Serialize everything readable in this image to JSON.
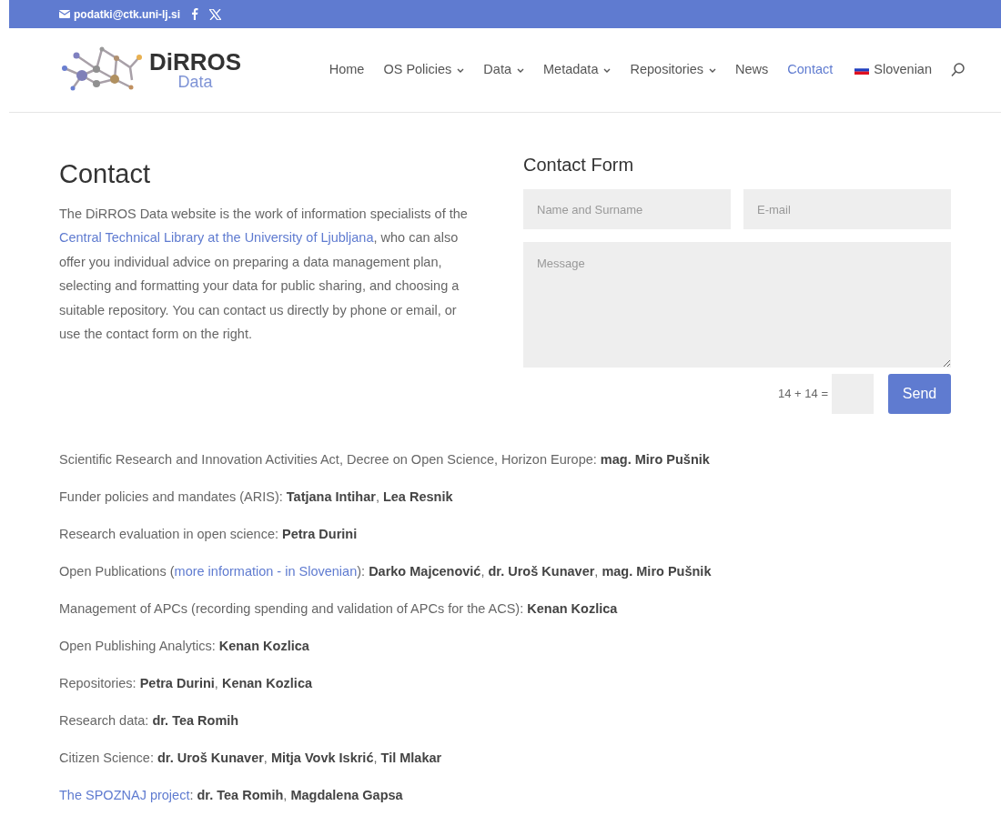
{
  "top_bar": {
    "email": "podatki@ctk.uni-lj.si"
  },
  "logo": {
    "name": "DiRROS",
    "sub": "Data"
  },
  "nav": [
    {
      "label": "Home",
      "dropdown": false,
      "selected": false
    },
    {
      "label": "OS Policies",
      "dropdown": true,
      "selected": false
    },
    {
      "label": "Data",
      "dropdown": true,
      "selected": false
    },
    {
      "label": "Metadata",
      "dropdown": true,
      "selected": false
    },
    {
      "label": "Repositories",
      "dropdown": true,
      "selected": false
    },
    {
      "label": "News",
      "dropdown": false,
      "selected": false
    },
    {
      "label": "Contact",
      "dropdown": false,
      "selected": true
    }
  ],
  "language": "Slovenian",
  "heading": "Contact",
  "intro": [
    {
      "kind": "text",
      "text": "The DiRROS Data website is the work of information specialists of the "
    },
    {
      "kind": "link",
      "text": "Central Technical Library at the University of Ljubljana"
    },
    {
      "kind": "text",
      "text": ", who can also offer you individual advice on preparing a data management plan, selecting and formatting your data for public sharing, and choosing a suitable repository. You can contact us directly by phone or email, or use the contact form on the right."
    }
  ],
  "form": {
    "title": "Contact Form",
    "name_placeholder": "Name and Surname",
    "email_placeholder": "E-mail",
    "message_placeholder": "Message",
    "captcha": "14 + 14 =",
    "send": "Send"
  },
  "contacts": [
    [
      {
        "kind": "text",
        "text": "Scientific Research and Innovation Activities Act, Decree on Open Science, Horizon Europe: **mag. Miro Pušnik**"
      }
    ],
    [
      {
        "kind": "text",
        "text": "Funder policies and mandates (ARIS): **Tatjana Intihar**, **Lea Resnik**"
      }
    ],
    [
      {
        "kind": "text",
        "text": "Research evaluation in open science: **Petra Durini**"
      }
    ],
    [
      {
        "kind": "text",
        "text": "Open Publications ("
      },
      {
        "kind": "link",
        "text": "more information - in Slovenian"
      },
      {
        "kind": "text",
        "text": "): **Darko Majcenović**, **dr. Uroš Kunaver**, **mag. Miro Pušnik**"
      }
    ],
    [
      {
        "kind": "text",
        "text": "Management of APCs (recording spending and validation of APCs for the ACS): **Kenan Kozlica**"
      }
    ],
    [
      {
        "kind": "text",
        "text": "Open Publishing Analytics: **Kenan Kozlica**"
      }
    ],
    [
      {
        "kind": "text",
        "text": "Repositories: **Petra Durini**, **Kenan Kozlica**"
      }
    ],
    [
      {
        "kind": "text",
        "text": "Research data: **dr. Tea Romih**"
      }
    ],
    [
      {
        "kind": "text",
        "text": "Citizen Science: **dr. Uroš Kunaver**, **Mitja Vovk Iskrić**, **Til Mlakar**"
      }
    ],
    [
      {
        "kind": "link",
        "text": "The SPOZNAJ project"
      },
      {
        "kind": "text",
        "text": ": **dr. Tea Romih**, **Magdalena Gapsa**"
      }
    ]
  ]
}
